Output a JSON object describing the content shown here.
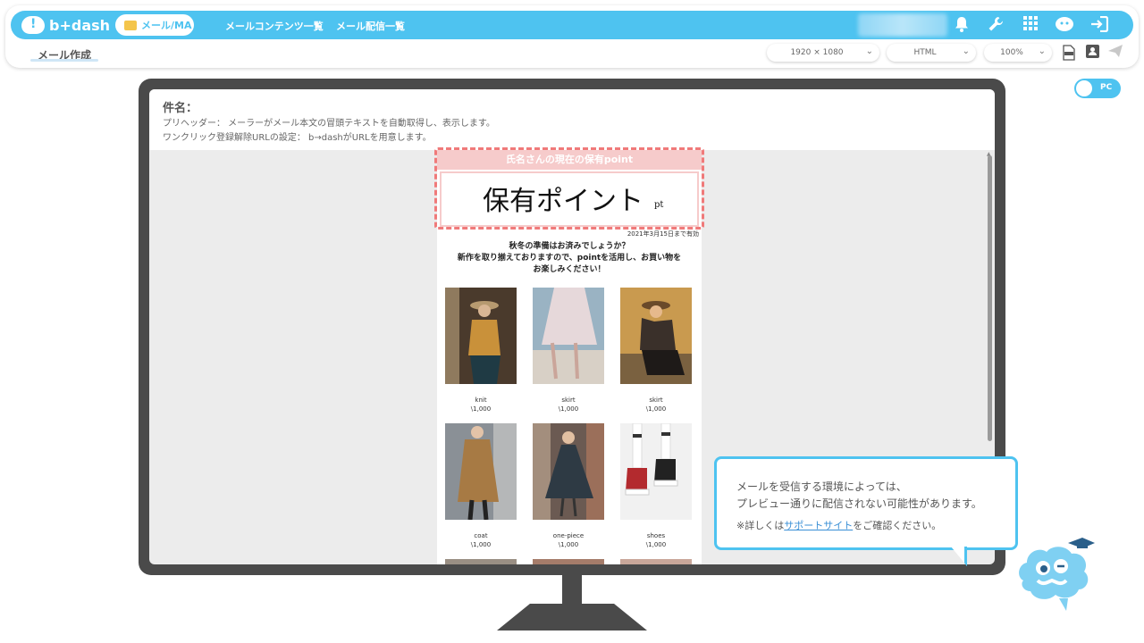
{
  "header": {
    "logo_text": "b+dash",
    "module_pill": "メール/MA",
    "nav": [
      "メールコンテンツ一覧",
      "メール配信一覧"
    ],
    "icons": [
      "bell-icon",
      "wrench-icon",
      "grid-icon",
      "support-icon",
      "logout-icon"
    ]
  },
  "toolbar": {
    "page_title": "メール作成",
    "resolution": "1920 × 1080",
    "format": "HTML",
    "zoom": "100%",
    "icons": [
      "html-file-icon",
      "contact-card-icon",
      "send-icon"
    ]
  },
  "preview_toggle": {
    "label": "PC",
    "on": true
  },
  "email_meta": {
    "subject_label": "件名：",
    "preheader": "プリヘッダー： メーラーがメール本文の冒頭テキストを自動取得し、表示します。",
    "unsubscribe": "ワンクリック登録解除URLの設定： b→dashがURLを用意します。"
  },
  "email": {
    "point_header": "氏名さんの現在の保有point",
    "point_value": "保有ポイント",
    "point_unit": "pt",
    "valid_until": "2021年3月15日まで有効",
    "intro_lines": [
      "秋冬の準備はお済みでしょうか？",
      "新作を取り揃えておりますので、pointを活用し、お買い物を",
      "お楽しみください！"
    ],
    "products": [
      {
        "name": "knit",
        "price": "\\1,000"
      },
      {
        "name": "skirt",
        "price": "\\1,000"
      },
      {
        "name": "skirt",
        "price": "\\1,000"
      },
      {
        "name": "coat",
        "price": "\\1,000"
      },
      {
        "name": "one-piece",
        "price": "\\1,000"
      },
      {
        "name": "shoes",
        "price": "\\1,000"
      }
    ]
  },
  "callout": {
    "line1": "メールを受信する環境によっては、",
    "line2": "プレビュー通りに配信されない可能性があります。",
    "note_prefix": "※詳しくは",
    "note_link": "サポートサイト",
    "note_suffix": "をご確認ください。"
  },
  "colors": {
    "brand": "#4ec3f0",
    "point_header_bg": "#f6cbcb",
    "dashed_border": "#f07a7a",
    "monitor": "#4a4a4a"
  }
}
